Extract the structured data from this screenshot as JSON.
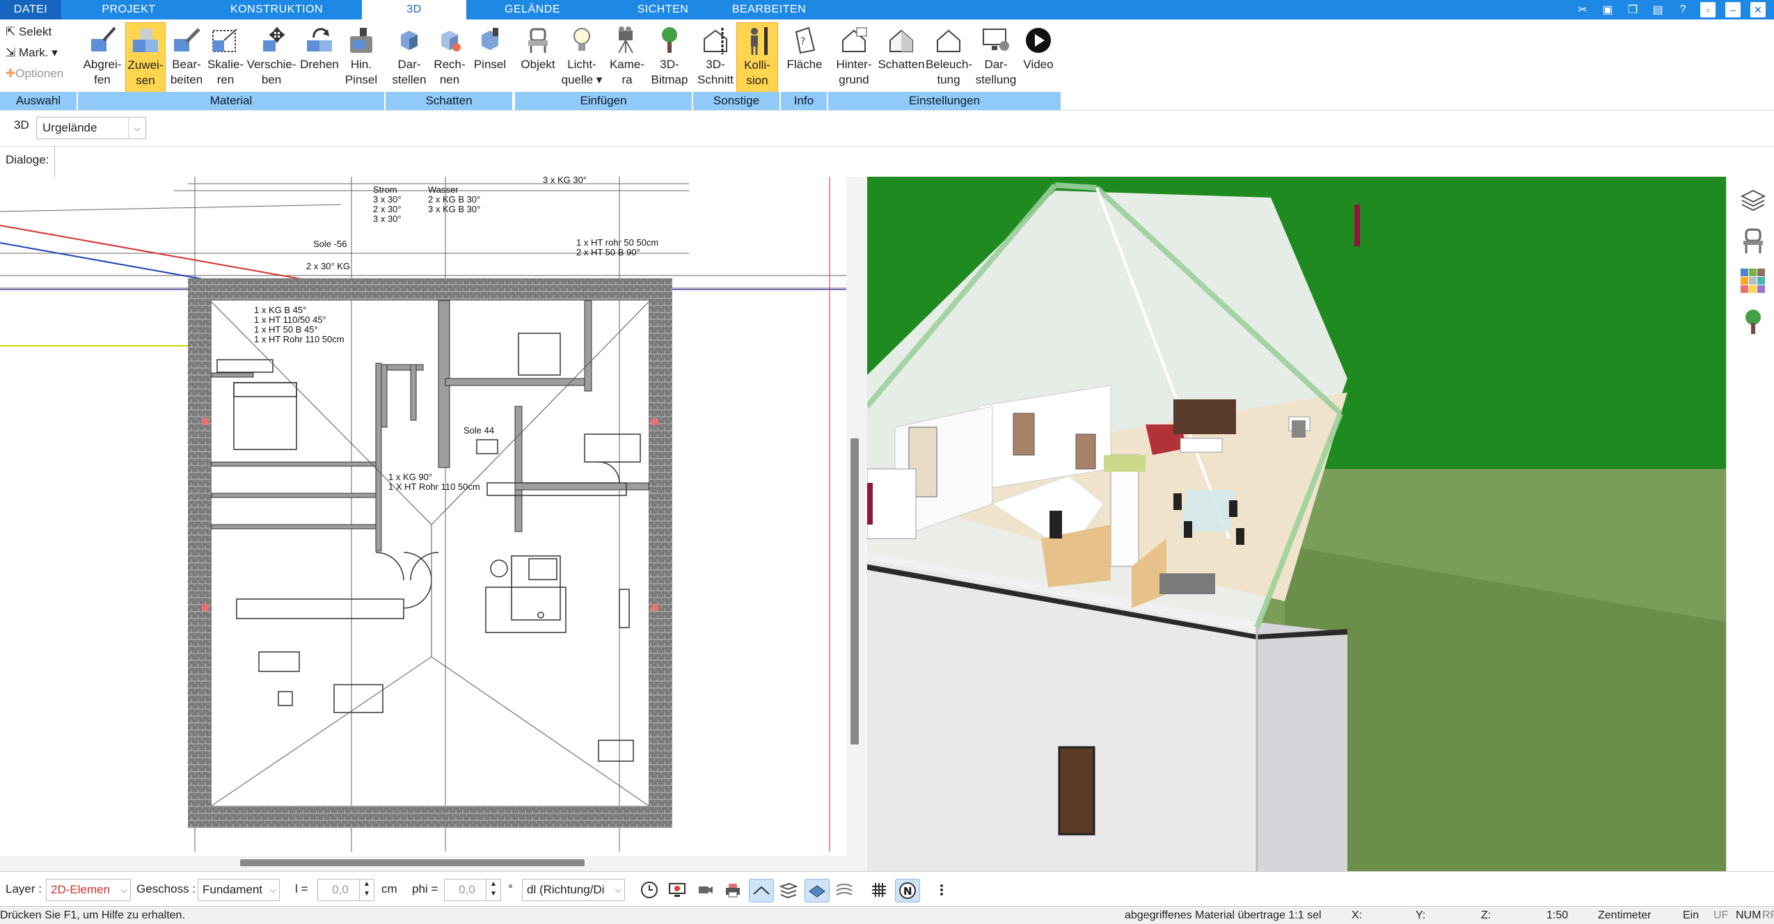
{
  "tabs": [
    {
      "label": "DATEI"
    },
    {
      "label": "PROJEKT"
    },
    {
      "label": "KONSTRUKTION"
    },
    {
      "label": "3D"
    },
    {
      "label": "GELÄNDE"
    },
    {
      "label": "SICHTEN"
    },
    {
      "label": "BEARBEITEN"
    }
  ],
  "ribbon": {
    "auswahl": {
      "selekt": "Selekt",
      "mark": "Mark.",
      "optionen": "Optionen",
      "group": "Auswahl"
    },
    "material": {
      "group": "Material",
      "buttons": [
        {
          "l1": "Abgrei-",
          "l2": "fen"
        },
        {
          "l1": "Zuwei-",
          "l2": "sen"
        },
        {
          "l1": "Bear-",
          "l2": "beiten"
        },
        {
          "l1": "Skalie-",
          "l2": "ren"
        },
        {
          "l1": "Verschie-",
          "l2": "ben"
        },
        {
          "l1": "Drehen",
          "l2": ""
        },
        {
          "l1": "Hin.",
          "l2": "Pinsel"
        }
      ]
    },
    "schatten": {
      "group": "Schatten",
      "buttons": [
        {
          "l1": "Dar-",
          "l2": "stellen"
        },
        {
          "l1": "Rech-",
          "l2": "nen"
        },
        {
          "l1": "Pinsel",
          "l2": ""
        }
      ]
    },
    "einfuegen": {
      "group": "Einfügen",
      "buttons": [
        {
          "l1": "Objekt",
          "l2": ""
        },
        {
          "l1": "Licht-",
          "l2": "quelle"
        },
        {
          "l1": "Kame-",
          "l2": "ra"
        },
        {
          "l1": "3D-",
          "l2": "Bitmap"
        }
      ]
    },
    "sonstige": {
      "group": "Sonstige",
      "buttons": [
        {
          "l1": "3D-",
          "l2": "Schnitt"
        },
        {
          "l1": "Kolli-",
          "l2": "sion"
        }
      ]
    },
    "info": {
      "group": "Info",
      "buttons": [
        {
          "l1": "Fläche",
          "l2": ""
        }
      ]
    },
    "einstellungen": {
      "group": "Einstellungen",
      "buttons": [
        {
          "l1": "Hinter-",
          "l2": "grund"
        },
        {
          "l1": "Schatten",
          "l2": ""
        },
        {
          "l1": "Beleuch-",
          "l2": "tung"
        },
        {
          "l1": "Dar-",
          "l2": "stellung"
        },
        {
          "l1": "Video",
          "l2": ""
        }
      ]
    }
  },
  "toolbar": {
    "mode": "3D",
    "terrain": "Urgelände",
    "dialoge": "Dialoge:"
  },
  "plan": {
    "texts": [
      "Strom",
      "3 x 30°",
      "2 x 30°",
      "3 x 30°",
      "Wasser",
      "2 x KG B 30°",
      "3 x KG B 30°",
      "3 x KG 30°",
      "Sole -56",
      "2 x 30° KG",
      "1 x HT rohr 50 50cm",
      "2 x HT 50 B 90°",
      "1 x KG B 45°",
      "1 x HT 110/50 45°",
      "1 x HT 50 B 45°",
      "1 x HT Rohr 110 50cm",
      "Sole 44",
      "1 x KG 90°",
      "1 X HT Rohr 110 50cm"
    ]
  },
  "bottom": {
    "layer_label": "Layer :",
    "layer_value": "2D-Elemen",
    "geschoss_label": "Geschoss :",
    "geschoss_value": "Fundament",
    "l_label": "l =",
    "l_value": "0,0",
    "l_unit": "cm",
    "phi_label": "phi =",
    "phi_value": "0,0",
    "phi_unit": "°",
    "dl_value": "dl (Richtung/Di"
  },
  "status": {
    "help": "Drücken Sie F1, um Hilfe zu erhalten.",
    "message": "abgegriffenes Material übertrage 1:1 sel",
    "x": "X:",
    "y": "Y:",
    "z": "Z:",
    "scale": "1:50",
    "unit": "Zentimeter",
    "ein": "Ein",
    "uf": "UF",
    "num": "NUM",
    "rf": "RF"
  },
  "colors": {
    "accent": "#1e88e5",
    "group_bg": "#90caf9",
    "selected": "#ffd54f",
    "grass": "#2e7d32"
  }
}
